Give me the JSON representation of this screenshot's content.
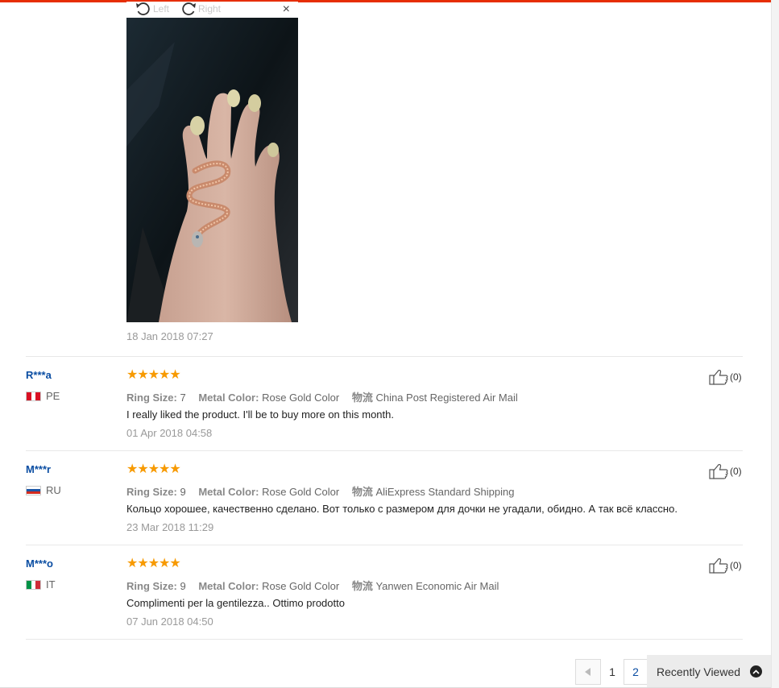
{
  "viewer": {
    "rotate_left_label": "Left",
    "rotate_right_label": "Right",
    "close_label": "×",
    "photo_date": "18 Jan 2018 07:27"
  },
  "reviews": [
    {
      "user": "R***a",
      "country": "PE",
      "flag_colors": [
        "#d91023",
        "#ffffff",
        "#d91023"
      ],
      "rating": 5,
      "stars": "★★★★★",
      "ring_size_label": "Ring Size:",
      "ring_size": "7",
      "metal_color_label": "Metal Color:",
      "metal_color": "Rose Gold Color",
      "logistics_label": "物流",
      "logistics": "China Post Registered Air Mail",
      "text": "I really liked the product. I'll be to buy more on this month.",
      "date": "01 Apr 2018 04:58",
      "helpful": "(0)"
    },
    {
      "user": "M***r",
      "country": "RU",
      "flag_colors": [
        "#ffffff",
        "#1c57a7",
        "#d52b1e"
      ],
      "rating": 5,
      "stars": "★★★★★",
      "ring_size_label": "Ring Size:",
      "ring_size": "9",
      "metal_color_label": "Metal Color:",
      "metal_color": "Rose Gold Color",
      "logistics_label": "物流",
      "logistics": "AliExpress Standard Shipping",
      "text": "Кольцо хорошее, качественно сделано. Вот только с размером для дочки не угадали, обидно. А так всё классно.",
      "date": "23 Mar 2018 11:29",
      "helpful": "(0)"
    },
    {
      "user": "M***o",
      "country": "IT",
      "flag_colors": [
        "#009246",
        "#ffffff",
        "#ce2b37"
      ],
      "rating": 5,
      "stars": "★★★★★",
      "ring_size_label": "Ring Size:",
      "ring_size": "9",
      "metal_color_label": "Metal Color:",
      "metal_color": "Rose Gold Color",
      "logistics_label": "物流",
      "logistics": "Yanwen Economic Air Mail",
      "text": "Complimenti per la gentilezza.. Ottimo prodotto",
      "date": "07 Jun 2018 04:50",
      "helpful": "(0)"
    }
  ],
  "pagination": {
    "pages": [
      "1",
      "2"
    ],
    "current": "2"
  },
  "recently_viewed": {
    "label": "Recently Viewed"
  },
  "colors": {
    "accent": "#e62e04",
    "link": "#0a4da2",
    "star": "#f79a02"
  }
}
